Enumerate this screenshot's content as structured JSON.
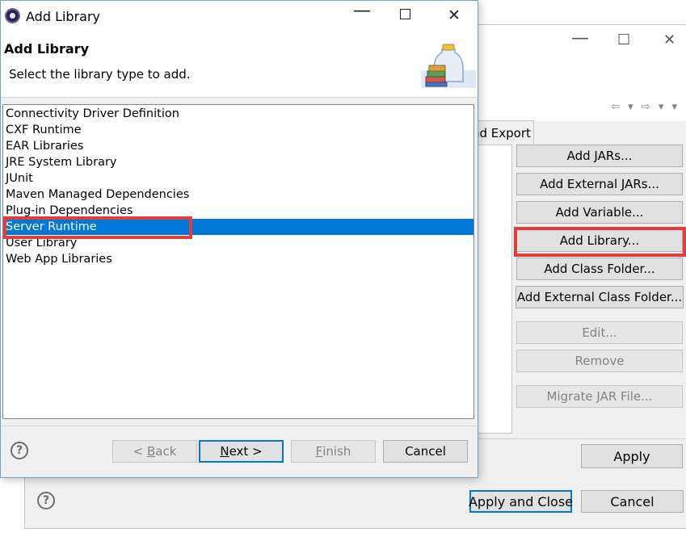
{
  "dialog": {
    "title": "Add Library",
    "heading": "Add Library",
    "subtitle": "Select the library type to add.",
    "library_types": [
      "Connectivity Driver Definition",
      "CXF Runtime",
      "EAR Libraries",
      "JRE System Library",
      "JUnit",
      "Maven Managed Dependencies",
      "Plug-in Dependencies",
      "Server Runtime",
      "User Library",
      "Web App Libraries"
    ],
    "selected_item": "Server Runtime",
    "buttons": {
      "back_mnemonic": "B",
      "back_rest": "ack",
      "back_prefix": "< ",
      "next_mnemonic": "N",
      "next_rest": "ext >",
      "finish_mnemonic": "F",
      "finish_rest": "inish",
      "cancel": "Cancel"
    },
    "help_symbol": "?"
  },
  "background_window": {
    "tab_label": "nd Export",
    "nav_glyphs": "⇦ ▾ ⇨ ▾ ▾",
    "side_buttons": {
      "add_jars": "Add JARs...",
      "add_external_jars": "Add External JARs...",
      "add_variable": "Add Variable...",
      "add_library": "Add Library...",
      "add_class_folder": "Add Class Folder...",
      "add_external_class_folder": "Add External Class Folder...",
      "edit": "Edit...",
      "remove": "Remove",
      "migrate_jar": "Migrate JAR File..."
    },
    "apply": "Apply",
    "apply_and_close": "Apply and Close",
    "cancel": "Cancel",
    "help_symbol": "?"
  },
  "colors": {
    "selection": "#0078d7",
    "highlight_box": "#e23c3c"
  }
}
